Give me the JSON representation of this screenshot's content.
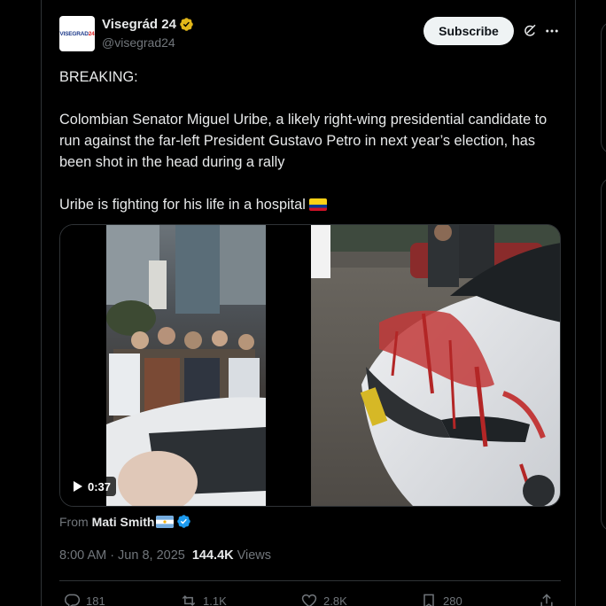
{
  "author": {
    "display_name": "Visegrád 24",
    "handle": "@visegrad24",
    "avatar_text_a": "VISEGRAD",
    "avatar_text_b": "24"
  },
  "header": {
    "subscribe_label": "Subscribe"
  },
  "tweet": {
    "line1": "BREAKING:",
    "line2": "Colombian Senator Miguel Uribe, a likely right-wing presidential candidate to run against the far-left President Gustavo Petro in next year’s election, has been shot in the head during a rally",
    "line3": "Uribe is fighting for his life in a hospital"
  },
  "media": {
    "duration": "0:37"
  },
  "attribution": {
    "from_label": "From",
    "from_name": "Mati Smith"
  },
  "meta": {
    "time": "8:00 AM",
    "separator": "·",
    "date": "Jun 8, 2025",
    "views_count": "144.4K",
    "views_label": "Views"
  },
  "actions": {
    "replies": "181",
    "reposts": "1.1K",
    "likes": "2.8K",
    "bookmarks": "280"
  },
  "colors": {
    "background": "#000000",
    "text": "#e7e9ea",
    "muted": "#71767b",
    "border": "#2f3336",
    "verified_gold": "#e2b719",
    "verified_blue": "#1d9bf0"
  },
  "icons": [
    "verified-gold-icon",
    "grok-icon",
    "more-icon",
    "colombia-flag-icon",
    "argentina-flag-icon",
    "verified-blue-icon",
    "play-icon",
    "reply-icon",
    "repost-icon",
    "like-icon",
    "bookmark-icon",
    "share-icon"
  ]
}
